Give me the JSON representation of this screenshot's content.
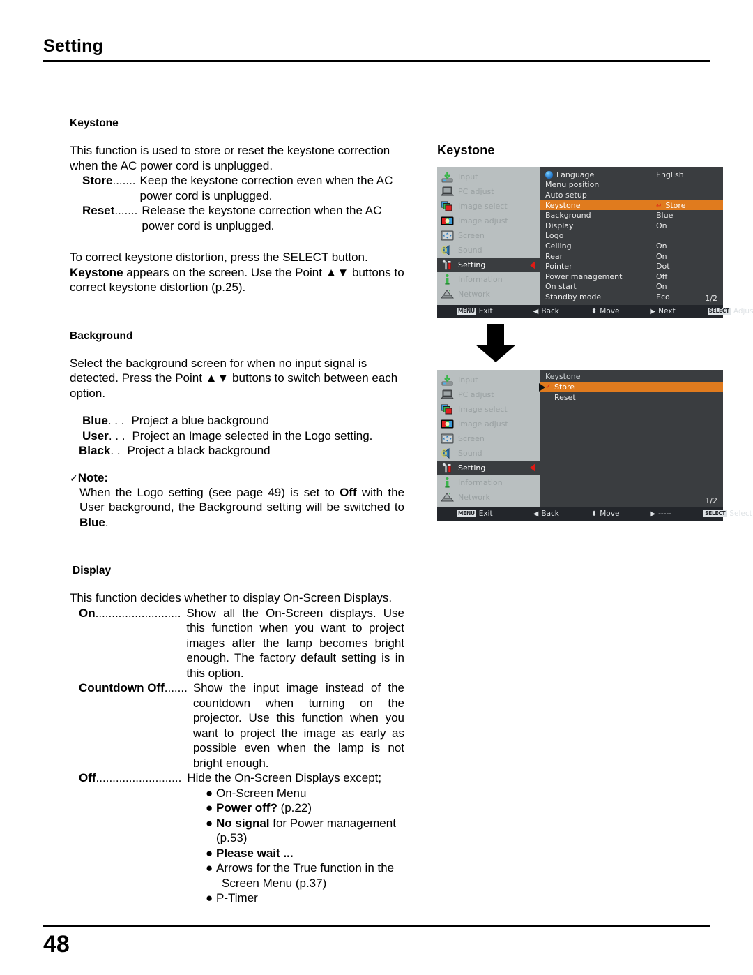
{
  "header": {
    "title": "Setting"
  },
  "footer": {
    "page_number": "48"
  },
  "sections": {
    "keystone": {
      "heading": "Keystone",
      "intro": "This function is used to store or reset the keystone correction when the AC power cord is unplugged.",
      "items": [
        {
          "label": "Store",
          "dots": " .......",
          "desc": "Keep the keystone correction even when the AC power cord is unplugged."
        },
        {
          "label": "Reset",
          "dots": ".......",
          "desc": "Release the keystone correction when the AC power cord is unplugged."
        }
      ],
      "outro_1": "To correct keystone distortion, press the SELECT button.",
      "outro_2_bold": "Keystone",
      "outro_2_rest": " appears on the screen. Use the Point ▲▼ buttons to correct keystone distortion (p.25)."
    },
    "background": {
      "heading": "Background",
      "intro": "Select the background screen for when no input signal is detected. Press the Point ▲▼ buttons to switch between each option.",
      "items": [
        {
          "label": "Blue",
          "dots": " . . .",
          "desc": "Project a blue background"
        },
        {
          "label": "User",
          "dots": " . . .",
          "desc": "Project an Image selected in the Logo setting."
        },
        {
          "label": "Black",
          "dots": " . .",
          "desc": "Project a black background"
        }
      ],
      "note": {
        "check": "✓",
        "title": "Note:",
        "text_1": "When the Logo setting (see page 49) is set to ",
        "bold_1": "Off",
        "text_2": " with the User background, the Background setting will be switched to ",
        "bold_2": "Blue",
        "text_3": "."
      }
    },
    "display": {
      "heading": "Display",
      "intro": "This function decides whether to display On-Screen Displays.",
      "items": [
        {
          "label": "On",
          "dots": " ..........................",
          "desc": "Show all the On-Screen displays. Use this function when you want to project images after the lamp becomes bright enough. The factory default setting is in this option."
        },
        {
          "label": "Countdown Off",
          "dots": ".......",
          "desc": "Show the input image instead of the countdown when turning on the projector. Use this function when you want to project the image as early as possible even when the lamp is not bright enough."
        }
      ],
      "off_item": {
        "label": "Off",
        "dots": " ..........................",
        "desc": "Hide the On-Screen Displays except;"
      },
      "off_bullets": [
        {
          "bullet": "●",
          "bold": "",
          "text": "On-Screen Menu"
        },
        {
          "bullet": "●",
          "bold": "Power off?",
          "text": " (p.22)"
        },
        {
          "bullet": "●",
          "bold": "No signal",
          "text": " for Power management"
        },
        {
          "bullet": "",
          "bold": "",
          "text": "(p.53)"
        },
        {
          "bullet": "●",
          "bold": "Please wait ...",
          "text": ""
        },
        {
          "bullet": "●",
          "bold": "",
          "text": "Arrows for the True function in the"
        },
        {
          "bullet": "",
          "bold": "",
          "text": "Screen Menu (p.37)"
        },
        {
          "bullet": "●",
          "bold": "",
          "text": "P-Timer"
        }
      ]
    }
  },
  "figure": {
    "title": "Keystone",
    "sidebar_items": [
      {
        "label": "Input",
        "icon": "input-icon",
        "selected": false
      },
      {
        "label": "PC adjust",
        "icon": "pc-adjust-icon",
        "selected": false
      },
      {
        "label": "Image select",
        "icon": "image-select-icon",
        "selected": false
      },
      {
        "label": "Image adjust",
        "icon": "image-adjust-icon",
        "selected": false
      },
      {
        "label": "Screen",
        "icon": "screen-icon",
        "selected": false
      },
      {
        "label": "Sound",
        "icon": "sound-icon",
        "selected": false
      },
      {
        "label": "Setting",
        "icon": "setting-icon",
        "selected": true
      },
      {
        "label": "Information",
        "icon": "information-icon",
        "selected": false
      },
      {
        "label": "Network",
        "icon": "network-icon",
        "selected": false
      }
    ],
    "menu_top": {
      "rows": [
        {
          "name": "Language",
          "value": "English",
          "icon": "globe-icon",
          "highlight": false,
          "enter": false
        },
        {
          "name": "Menu position",
          "value": "",
          "highlight": false,
          "enter": false
        },
        {
          "name": "Auto setup",
          "value": "",
          "highlight": false,
          "enter": false
        },
        {
          "name": "Keystone",
          "value": "Store",
          "highlight": true,
          "enter": true
        },
        {
          "name": "Background",
          "value": "Blue",
          "highlight": false,
          "enter": false
        },
        {
          "name": "Display",
          "value": "On",
          "highlight": false,
          "enter": false
        },
        {
          "name": "Logo",
          "value": "",
          "highlight": false,
          "enter": false
        },
        {
          "name": "Ceiling",
          "value": "On",
          "highlight": false,
          "enter": false
        },
        {
          "name": "Rear",
          "value": "On",
          "highlight": false,
          "enter": false
        },
        {
          "name": "Pointer",
          "value": "Dot",
          "highlight": false,
          "enter": false
        },
        {
          "name": "Power management",
          "value": "Off",
          "highlight": false,
          "enter": false
        },
        {
          "name": "On start",
          "value": "On",
          "highlight": false,
          "enter": false
        },
        {
          "name": "Standby mode",
          "value": "Eco",
          "highlight": false,
          "enter": false
        }
      ],
      "page_indicator": "1/2",
      "footer": [
        {
          "key": "MENU",
          "glyph": "",
          "label": "Exit"
        },
        {
          "key": "",
          "glyph": "◀",
          "label": "Back"
        },
        {
          "key": "",
          "glyph": "⬍",
          "label": "Move"
        },
        {
          "key": "",
          "glyph": "▶",
          "label": "Next"
        },
        {
          "key": "SELECT",
          "glyph": "",
          "label": "Adjust"
        }
      ]
    },
    "menu_bottom": {
      "submenu_title": "Keystone",
      "options": [
        {
          "label": "Store",
          "checked": true,
          "highlight": true
        },
        {
          "label": "Reset",
          "checked": false,
          "highlight": false
        }
      ],
      "page_indicator": "1/2",
      "footer": [
        {
          "key": "MENU",
          "glyph": "",
          "label": "Exit"
        },
        {
          "key": "",
          "glyph": "◀",
          "label": "Back"
        },
        {
          "key": "",
          "glyph": "⬍",
          "label": "Move"
        },
        {
          "key": "",
          "glyph": "▶",
          "label": "-----"
        },
        {
          "key": "SELECT",
          "glyph": "",
          "label": "Select"
        }
      ]
    },
    "accent_highlight": "#e07b1e",
    "accent_red": "#e01b15",
    "panel_bg": "#3a3d40",
    "sidebar_bg": "#b9bfc0"
  }
}
